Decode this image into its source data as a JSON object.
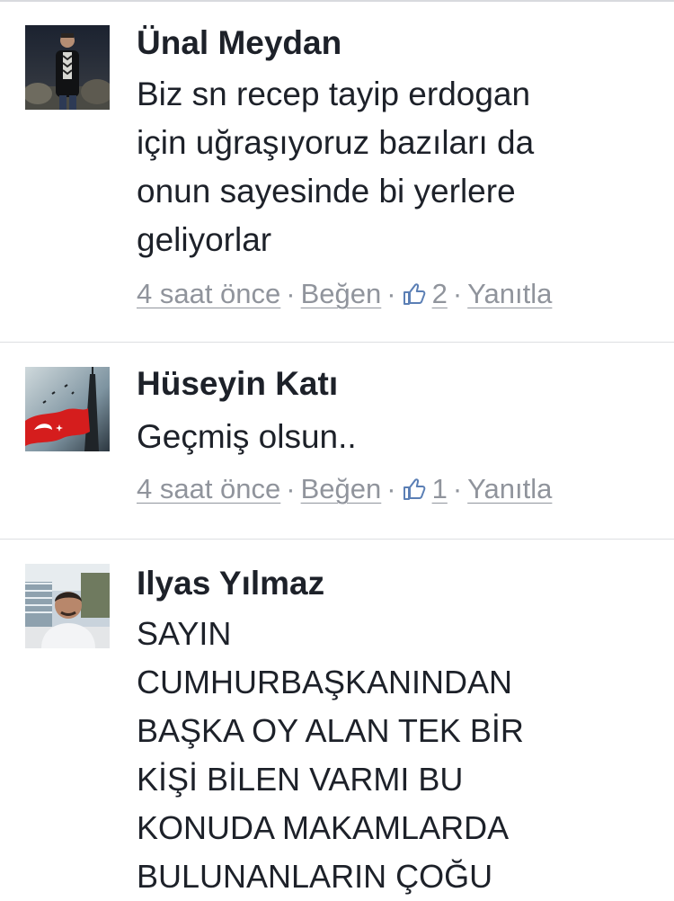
{
  "comments": [
    {
      "author": "Ünal Meydan",
      "text": "Biz sn recep tayip erdogan\niçin uğraşıyoruz bazıları da\nonun sayesinde bi yerlere\ngeliyorlar",
      "time": "4 saat önce",
      "like_label": "Beğen",
      "like_count": "2",
      "reply_label": "Yanıtla",
      "avatar_icon": "person-photo"
    },
    {
      "author": "Hüseyin Katı",
      "text": "Geçmiş olsun..",
      "time": "4 saat önce",
      "like_label": "Beğen",
      "like_count": "1",
      "reply_label": "Yanıtla",
      "avatar_icon": "flag-photo"
    },
    {
      "author": "Ilyas Yılmaz",
      "text": "SAYIN\nCUMHURBAŞKANINDAN\nBAŞKA OY ALAN TEK BİR\nKİŞİ BİLEN VARMI BU\nKONUDA MAKAMLARDA\nBULUNANLARIN ÇOĞU",
      "avatar_icon": "person-photo"
    }
  ],
  "separator": "·",
  "colors": {
    "text": "#1d2129",
    "meta": "#90949c",
    "divider": "#dddfe2"
  }
}
